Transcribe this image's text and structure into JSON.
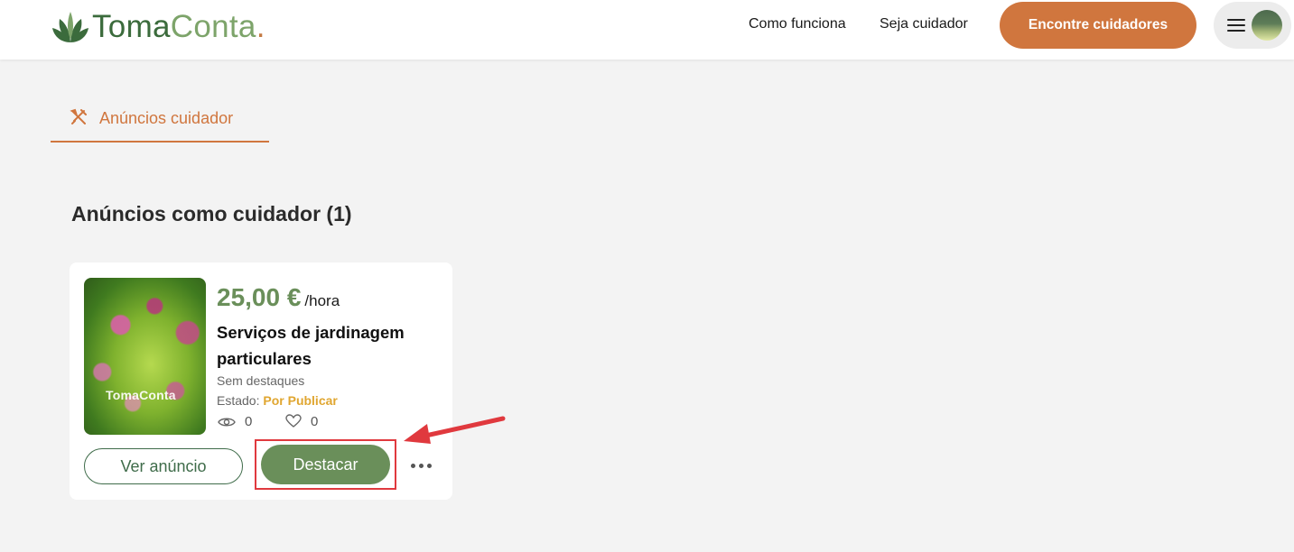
{
  "header": {
    "logo": {
      "part1": "Toma",
      "part2": "Conta",
      "dot": "."
    },
    "nav": {
      "how_it_works": "Como funciona",
      "become_caregiver": "Seja cuidador"
    },
    "cta_label": "Encontre cuidadores"
  },
  "tab": {
    "label": "Anúncios cuidador",
    "icon": "tools-icon"
  },
  "section": {
    "title": "Anúncios como cuidador (1)"
  },
  "listing": {
    "image_watermark": "TomaConta",
    "price": "25,00 €",
    "price_unit": "/hora",
    "title": "Serviços de jardinagem particulares",
    "highlights": "Sem destaques",
    "status_label": "Estado:",
    "status_value": "Por Publicar",
    "views": "0",
    "likes": "0",
    "view_button": "Ver anúncio",
    "feature_button": "Destacar",
    "more_icon": "more-icon"
  },
  "colors": {
    "accent_orange": "#d0763e",
    "brand_green": "#6a8f5a",
    "dark_green": "#3f6c4a",
    "status_yellow": "#e0a630",
    "annotation_red": "#e0393e"
  }
}
